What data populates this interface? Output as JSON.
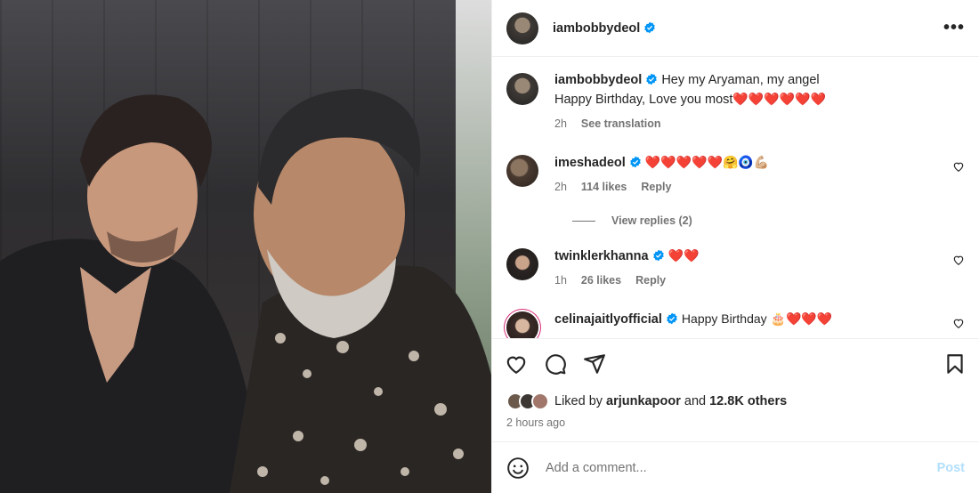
{
  "post": {
    "username": "iambobbydeol",
    "more_icon": "more-horizontal-icon"
  },
  "caption": {
    "username": "iambobbydeol",
    "line1": "Hey my Aryaman, my angel",
    "line2": "Happy Birthday, Love you most",
    "hearts": "❤️❤️❤️❤️❤️❤️",
    "time": "2h",
    "translate": "See translation"
  },
  "comments": [
    {
      "username": "imeshadeol",
      "text": "❤️❤️❤️❤️❤️🤗🧿💪🏼",
      "time": "2h",
      "likes": "114 likes",
      "reply": "Reply"
    },
    {
      "username": "twinklerkhanna",
      "text": "❤️❤️",
      "time": "1h",
      "likes": "26 likes",
      "reply": "Reply"
    },
    {
      "username": "celinajaitlyofficial",
      "text": "Happy Birthday 🎂❤️❤️❤️"
    }
  ],
  "view_replies": "View replies (2)",
  "likes": {
    "prefix": "Liked by",
    "user": "arjunkapoor",
    "middle": "and",
    "others": "12.8K others"
  },
  "timestamp": "2 hours ago",
  "composer": {
    "placeholder": "Add a comment...",
    "post_label": "Post"
  },
  "colors": {
    "verified": "#0095f6",
    "muted": "#737373",
    "post_disabled": "#b2dffc"
  }
}
